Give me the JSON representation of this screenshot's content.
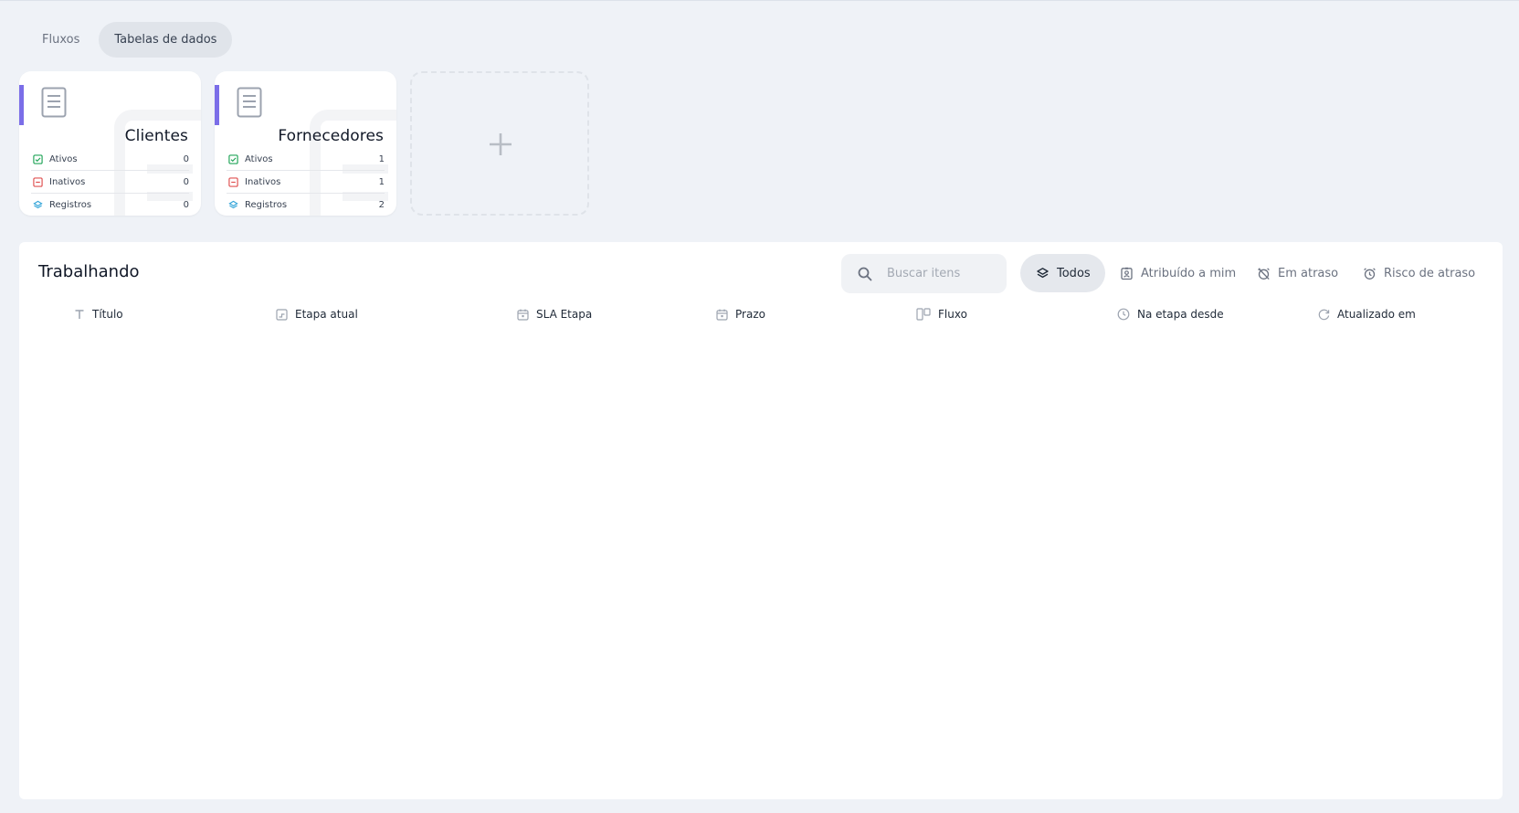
{
  "tabs": [
    {
      "label": "Fluxos",
      "active": false
    },
    {
      "label": "Tabelas de dados",
      "active": true
    }
  ],
  "cards": [
    {
      "name": "Clientes",
      "accent": "#7b6ee8",
      "stats": [
        {
          "label": "Ativos",
          "value": "0",
          "icon": "check-square-icon",
          "color": "#22a559"
        },
        {
          "label": "Inativos",
          "value": "0",
          "icon": "minus-square-icon",
          "color": "#e05252"
        },
        {
          "label": "Registros",
          "value": "0",
          "icon": "layers-icon",
          "color": "#2fa3d8"
        }
      ]
    },
    {
      "name": "Fornecedores",
      "accent": "#7b6ee8",
      "stats": [
        {
          "label": "Ativos",
          "value": "1",
          "icon": "check-square-icon",
          "color": "#22a559"
        },
        {
          "label": "Inativos",
          "value": "1",
          "icon": "minus-square-icon",
          "color": "#e05252"
        },
        {
          "label": "Registros",
          "value": "2",
          "icon": "layers-icon",
          "color": "#2fa3d8"
        }
      ]
    }
  ],
  "add_card": {
    "icon": "plus-icon"
  },
  "work": {
    "title": "Trabalhando",
    "search_placeholder": "Buscar itens",
    "search_value": "",
    "filters": [
      {
        "label": "Todos",
        "icon": "layers-icon",
        "active": true
      },
      {
        "label": "Atribuído a mim",
        "icon": "badge-user-icon",
        "active": false
      },
      {
        "label": "Em atraso",
        "icon": "alarm-off-icon",
        "active": false
      },
      {
        "label": "Risco de atraso",
        "icon": "alarm-icon",
        "active": false
      }
    ],
    "columns": [
      {
        "label": "Título",
        "icon": "text-t-icon"
      },
      {
        "label": "Etapa atual",
        "icon": "stage-icon"
      },
      {
        "label": "SLA Etapa",
        "icon": "calendar-icon"
      },
      {
        "label": "Prazo",
        "icon": "calendar-icon"
      },
      {
        "label": "Fluxo",
        "icon": "kanban-icon"
      },
      {
        "label": "Na etapa desde",
        "icon": "clock-icon"
      },
      {
        "label": "Atualizado em",
        "icon": "refresh-icon"
      }
    ]
  }
}
